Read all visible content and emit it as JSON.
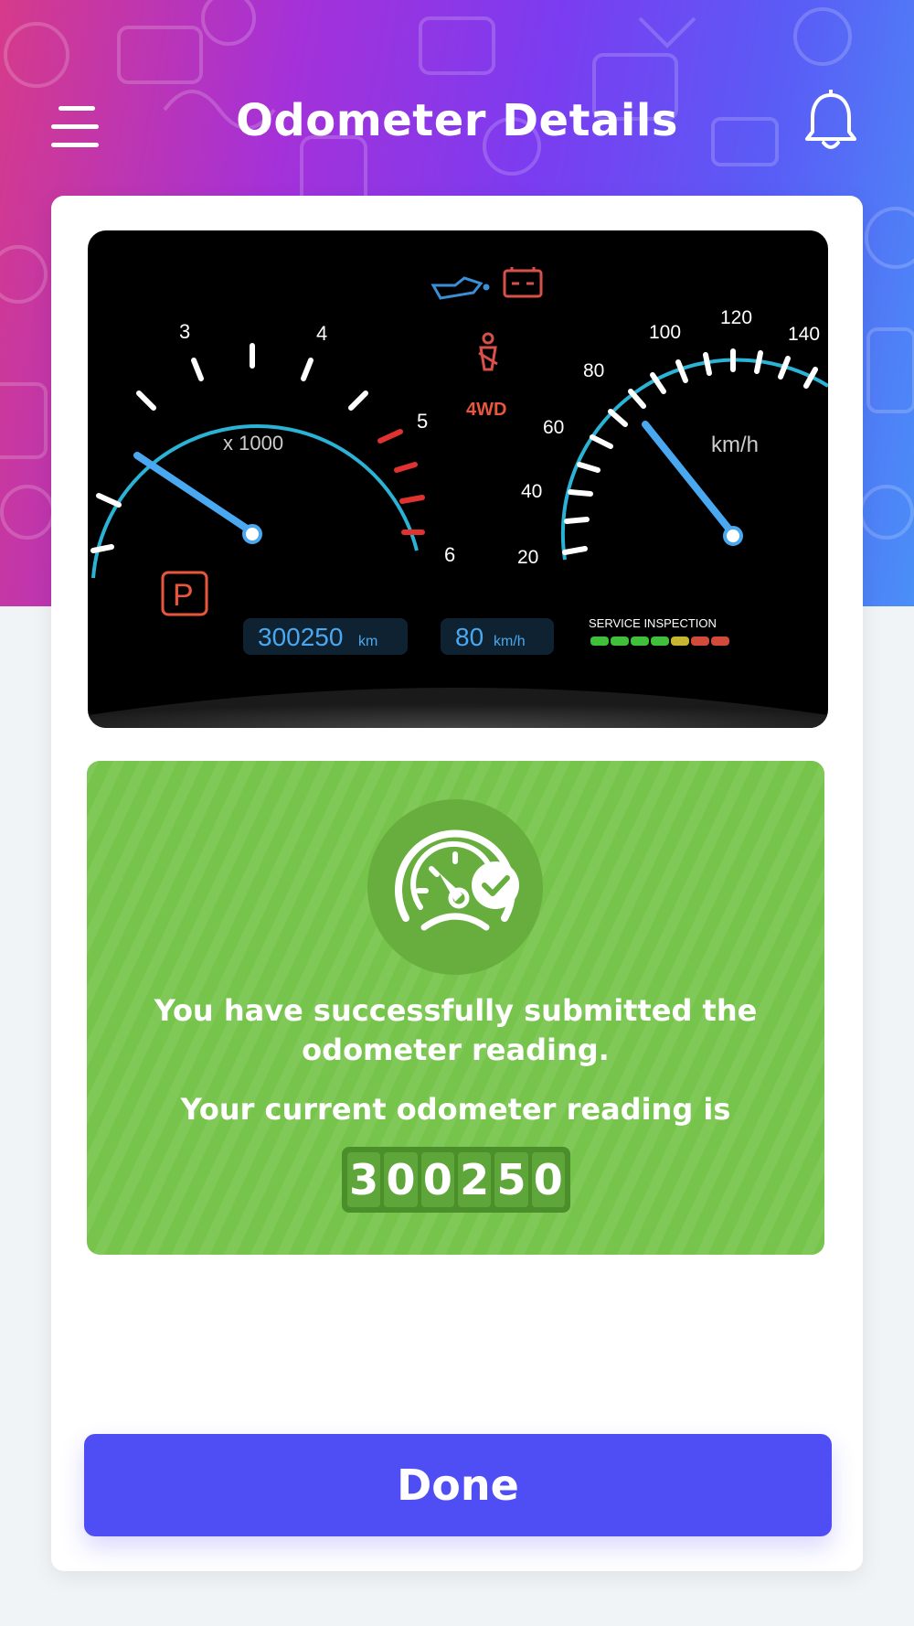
{
  "header": {
    "title": "Odometer Details",
    "gradient_colors": [
      "#d63a8a",
      "#7b3cf0",
      "#4a8ff7"
    ]
  },
  "dashboard": {
    "tach_labels": [
      "3",
      "4",
      "5",
      "6"
    ],
    "tach_unit": "x 1000",
    "speed_labels": [
      "20",
      "40",
      "60",
      "80",
      "100",
      "120",
      "140"
    ],
    "speed_unit": "km/h",
    "indicator_4wd": "4WD",
    "gear": "P",
    "odometer_value": "300250",
    "odometer_unit": "km",
    "speed_value": "80",
    "speed_value_unit": "km/h",
    "service_label": "SERVICE INSPECTION",
    "service_level_colors": [
      "#3fbf3a",
      "#3fbf3a",
      "#3fbf3a",
      "#3fbf3a",
      "#c9b630",
      "#d24a3a",
      "#d24a3a"
    ]
  },
  "success": {
    "icon": "speedometer-check-icon",
    "message": "You have successfully submitted the odometer reading.",
    "subtext": "Your current odometer reading is",
    "reading_digits": [
      "3",
      "0",
      "0",
      "2",
      "5",
      "0"
    ],
    "color": "#76c44b"
  },
  "actions": {
    "done_label": "Done",
    "accent": "#4f4ef4"
  }
}
